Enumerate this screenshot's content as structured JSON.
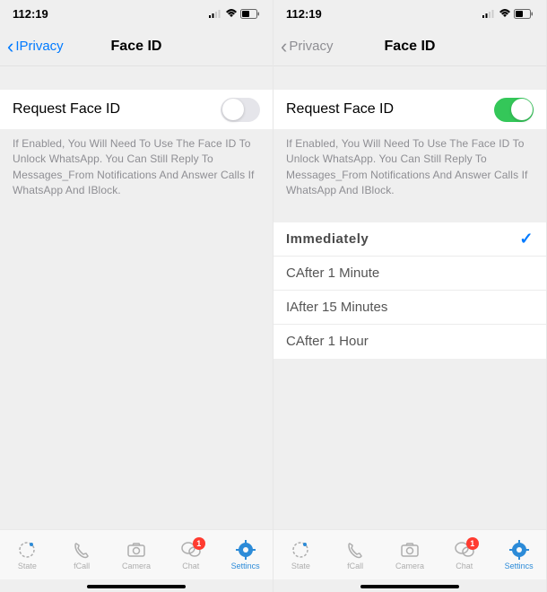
{
  "left": {
    "status": {
      "time": "112:19"
    },
    "nav": {
      "back_label": "IPrivacy",
      "title": "Face ID"
    },
    "request": {
      "label": "Request Face ID",
      "enabled": false
    },
    "helper": "If Enabled, You Will Need To Use The Face ID To Unlock WhatsApp. You Can Still Reply To Messages_From Notifications And Answer Calls If WhatsApp And IBlock."
  },
  "right": {
    "status": {
      "time": "112:19"
    },
    "nav": {
      "back_label": "Privacy",
      "title": "Face ID"
    },
    "request": {
      "label": "Request Face ID",
      "enabled": true
    },
    "helper": "If Enabled, You Will Need To Use The Face ID To Unlock WhatsApp. You Can Still Reply To Messages_From Notifications And Answer Calls If WhatsApp And IBlock.",
    "options": [
      {
        "label": "Immediately",
        "selected": true
      },
      {
        "label": "CAfter 1 Minute",
        "selected": false
      },
      {
        "label": "IAfter 15 Minutes",
        "selected": false
      },
      {
        "label": "CAfter 1 Hour",
        "selected": false
      }
    ]
  },
  "tabs": [
    {
      "key": "state",
      "label": "State"
    },
    {
      "key": "call",
      "label": "fCall"
    },
    {
      "key": "camera",
      "label": "Camera"
    },
    {
      "key": "chat",
      "label": "Chat",
      "badge": "1"
    },
    {
      "key": "settings",
      "label": "Settіnсs",
      "active": true
    }
  ]
}
